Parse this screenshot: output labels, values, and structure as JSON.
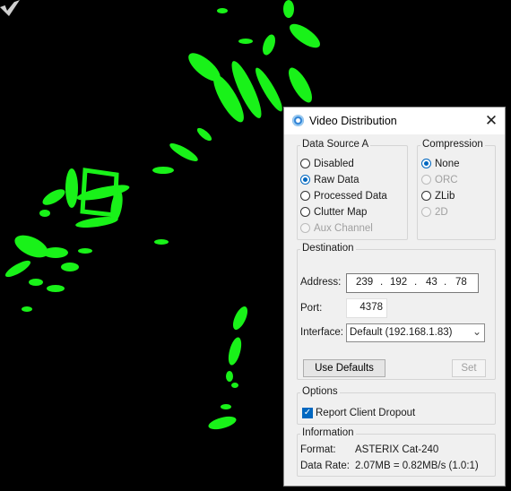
{
  "dialog": {
    "title": "Video Distribution",
    "close_icon": "close-icon",
    "app_icon": "radar-icon"
  },
  "data_source": {
    "label": "Data Source A",
    "options": [
      {
        "label": "Disabled",
        "checked": false,
        "enabled": true
      },
      {
        "label": "Raw Data",
        "checked": true,
        "enabled": true
      },
      {
        "label": "Processed Data",
        "checked": false,
        "enabled": true
      },
      {
        "label": "Clutter Map",
        "checked": false,
        "enabled": true
      },
      {
        "label": "Aux Channel",
        "checked": false,
        "enabled": false
      }
    ]
  },
  "compression": {
    "label": "Compression",
    "options": [
      {
        "label": "None",
        "checked": true,
        "enabled": true
      },
      {
        "label": "ORC",
        "checked": false,
        "enabled": false
      },
      {
        "label": "ZLib",
        "checked": false,
        "enabled": true
      },
      {
        "label": "2D",
        "checked": false,
        "enabled": false
      }
    ]
  },
  "destination": {
    "label": "Destination",
    "address_label": "Address:",
    "address": [
      "239",
      "192",
      "43",
      "78"
    ],
    "ip_separator": ".",
    "port_label": "Port:",
    "port": "4378",
    "interface_label": "Interface:",
    "interface_value": "Default (192.168.1.83)",
    "use_defaults_label": "Use Defaults",
    "set_label": "Set"
  },
  "options": {
    "label": "Options",
    "report_client_dropout_label": "Report Client Dropout",
    "report_client_dropout_checked": true
  },
  "information": {
    "label": "Information",
    "format_label": "Format:",
    "format_value": "ASTERIX Cat-240",
    "data_rate_label": "Data Rate:",
    "data_rate_value": "2.07MB = 0.82MB/s (1.0:1)"
  },
  "colors": {
    "background": "#000000",
    "radar_echo": "#19f219",
    "accent": "#0067c0",
    "dialog_bg": "#f0f0f0"
  }
}
